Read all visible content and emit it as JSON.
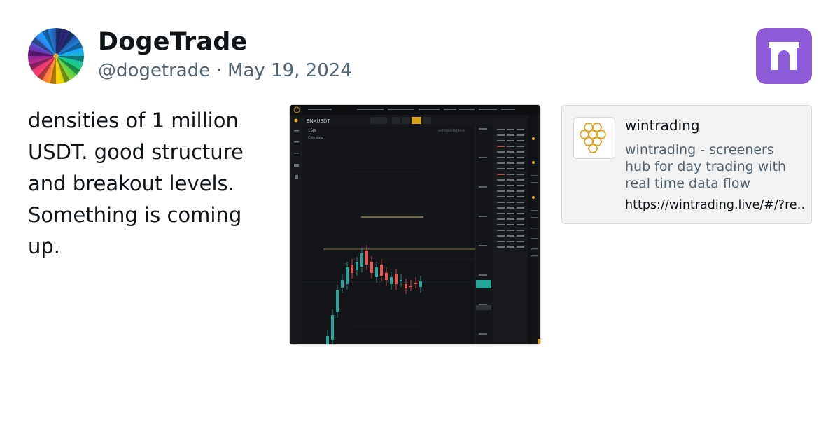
{
  "author": {
    "name": "DogeTrade",
    "handle": "@dogetrade",
    "separator": " · ",
    "date": "May 19, 2024"
  },
  "tweet": {
    "text": "densities of 1 million USDT. good structure and breakout levels. Something is coming up."
  },
  "site_logo_icon": "archway-icon",
  "screenshot": {
    "symbol": "BNXUSDT",
    "timeframe": "15m",
    "subtitle": "Coin data",
    "watermark": "wintrading.live"
  },
  "link_card": {
    "title": "wintrading",
    "description": "wintrading - screeners hub for day trading with real time data flow",
    "url": "https://wintrading.live/#/?re…",
    "logo_icon": "honeycomb-icon"
  },
  "colors": {
    "brand_purple": "#8d5bd6",
    "candle_up": "#26a69a",
    "candle_down": "#ef5350",
    "level_line": "#d4c05a",
    "honeycomb": "#d9a21b"
  }
}
